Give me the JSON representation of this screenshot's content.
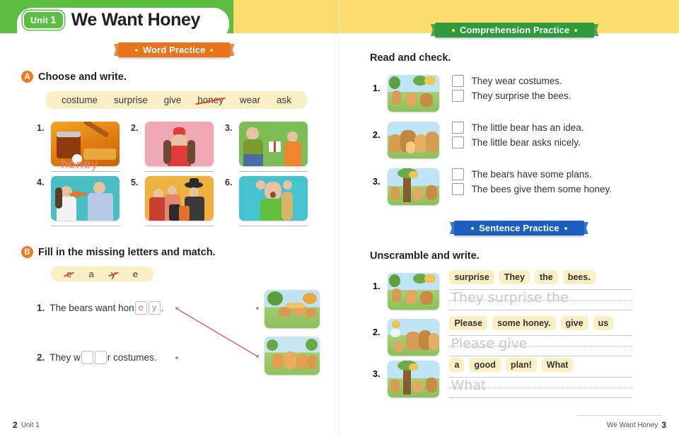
{
  "header": {
    "unit_label": "Unit",
    "unit_number": "1",
    "title": "We Want Honey"
  },
  "left_page": {
    "ribbon": "Word Practice",
    "section_a": {
      "badge": "A",
      "title": "Choose and write.",
      "word_bank": [
        {
          "word": "costume",
          "struck": false
        },
        {
          "word": "surprise",
          "struck": false
        },
        {
          "word": "give",
          "struck": false
        },
        {
          "word": "honey",
          "struck": true
        },
        {
          "word": "wear",
          "struck": false
        },
        {
          "word": "ask",
          "struck": false
        }
      ],
      "items": [
        {
          "num": "1.",
          "answer": "honey",
          "image": "honey-jar-dipper-photo",
          "c1": "#E8922B",
          "c2": "#F2B24A"
        },
        {
          "num": "2.",
          "answer": "",
          "image": "girl-red-hat-pink-background-photo",
          "c1": "#F0A9B4",
          "c2": "#E98FA0"
        },
        {
          "num": "3.",
          "answer": "",
          "image": "man-giving-gift-to-girl-photo",
          "c1": "#7DBD55",
          "c2": "#69AD46"
        },
        {
          "num": "4.",
          "answer": "",
          "image": "woman-asking-man-teal-background-photo",
          "c1": "#49BFC4",
          "c2": "#3FACB5"
        },
        {
          "num": "5.",
          "answer": "",
          "image": "family-in-halloween-costumes-photo",
          "c1": "#F0B23F",
          "c2": "#E8A12C"
        },
        {
          "num": "6.",
          "answer": "",
          "image": "surprised-girl-green-shirt-photo",
          "c1": "#45C3CE",
          "c2": "#36B0BE"
        }
      ]
    },
    "section_b": {
      "badge": "B",
      "title": "Fill in the missing letters and match.",
      "letter_bank": [
        {
          "letter": "e",
          "struck": true
        },
        {
          "letter": "a",
          "struck": false
        },
        {
          "letter": "y",
          "struck": true
        },
        {
          "letter": "e",
          "struck": false
        }
      ],
      "items": [
        {
          "num": "1.",
          "before": "The bears want hon",
          "boxes": [
            "e",
            "y"
          ],
          "after": "."
        },
        {
          "num": "2.",
          "before": "They w",
          "boxes": [
            "",
            ""
          ],
          "after": "r costumes."
        }
      ],
      "thumbs": [
        {
          "image": "bears-and-bees-at-hive-illustration"
        },
        {
          "image": "bears-in-costumes-group-illustration"
        }
      ]
    },
    "footer": {
      "page": "2",
      "label": "Unit 1"
    }
  },
  "right_page": {
    "comprehension": {
      "ribbon": "Comprehension Practice",
      "title": "Read and check.",
      "items": [
        {
          "num": "1.",
          "image": "bears-playing-under-beehive-tree-illustration",
          "options": [
            "They wear costumes.",
            "They surprise the bees."
          ]
        },
        {
          "num": "2.",
          "image": "bear-family-gathered-illustration",
          "options": [
            "The little bear has an idea.",
            "The little bear asks nicely."
          ]
        },
        {
          "num": "3.",
          "image": "bears-beside-tree-with-hive-illustration",
          "options": [
            "The bears have some plans.",
            "The bees give them some honey."
          ]
        }
      ]
    },
    "sentence": {
      "ribbon": "Sentence Practice",
      "title": "Unscramble and write.",
      "items": [
        {
          "num": "1.",
          "image": "bears-playing-under-beehive-tree-illustration",
          "chips": [
            "surprise",
            "They",
            "the",
            "bees."
          ],
          "trace": "They surprise the"
        },
        {
          "num": "2.",
          "image": "bears-resting-with-honey-pot-illustration",
          "chips": [
            "Please",
            "some honey.",
            "give",
            "us"
          ],
          "trace": "Please give"
        },
        {
          "num": "3.",
          "image": "bears-beside-tree-with-hive-illustration",
          "chips": [
            "a",
            "good",
            "plan!",
            "What"
          ],
          "trace": "What"
        }
      ]
    },
    "footer": {
      "label": "We Want Honey",
      "page": "3"
    }
  },
  "colors": {
    "green": "#5BBE43",
    "yellow": "#FBDC6C",
    "orange": "#E8741E",
    "ribbon_green": "#2E9A3E",
    "ribbon_blue": "#1A5FC0",
    "cream": "#FBEFC4",
    "handwriting": "#F08080"
  }
}
